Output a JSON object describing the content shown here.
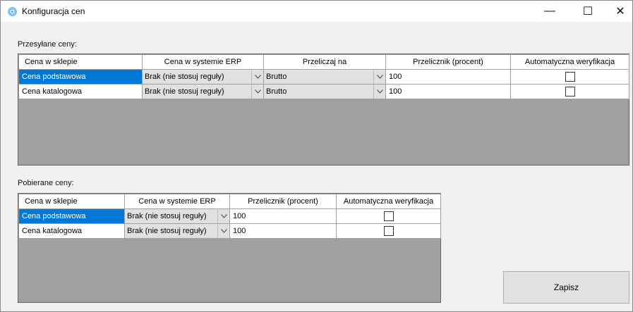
{
  "window": {
    "title": "Konfiguracja cen",
    "minimize": "—",
    "maximize": "☐",
    "close": "✕"
  },
  "sent": {
    "label": "Przesyłane ceny:",
    "headers": [
      "Cena w sklepie",
      "Cena w systemie ERP",
      "Przeliczaj na",
      "Przelicznik (procent)",
      "Automatyczna weryfikacja"
    ],
    "rows": [
      {
        "shop": "Cena podstawowa",
        "erp": "Brak (nie stosuj reguły)",
        "convert": "Brutto",
        "factor": "100",
        "auto": false
      },
      {
        "shop": "Cena katalogowa",
        "erp": "Brak (nie stosuj reguły)",
        "convert": "Brutto",
        "factor": "100",
        "auto": false
      }
    ]
  },
  "received": {
    "label": "Pobierane ceny:",
    "headers": [
      "Cena w sklepie",
      "Cena w systemie ERP",
      "Przelicznik (procent)",
      "Automatyczna weryfikacja"
    ],
    "rows": [
      {
        "shop": "Cena podstawowa",
        "erp": "Brak (nie stosuj reguły)",
        "factor": "100",
        "auto": false
      },
      {
        "shop": "Cena katalogowa",
        "erp": "Brak (nie stosuj reguły)",
        "factor": "100",
        "auto": false
      }
    ]
  },
  "save_label": "Zapisz",
  "colors": {
    "selection": "#0078d7",
    "grid_empty": "#a0a0a0",
    "form_bg": "#f0f0f0"
  }
}
